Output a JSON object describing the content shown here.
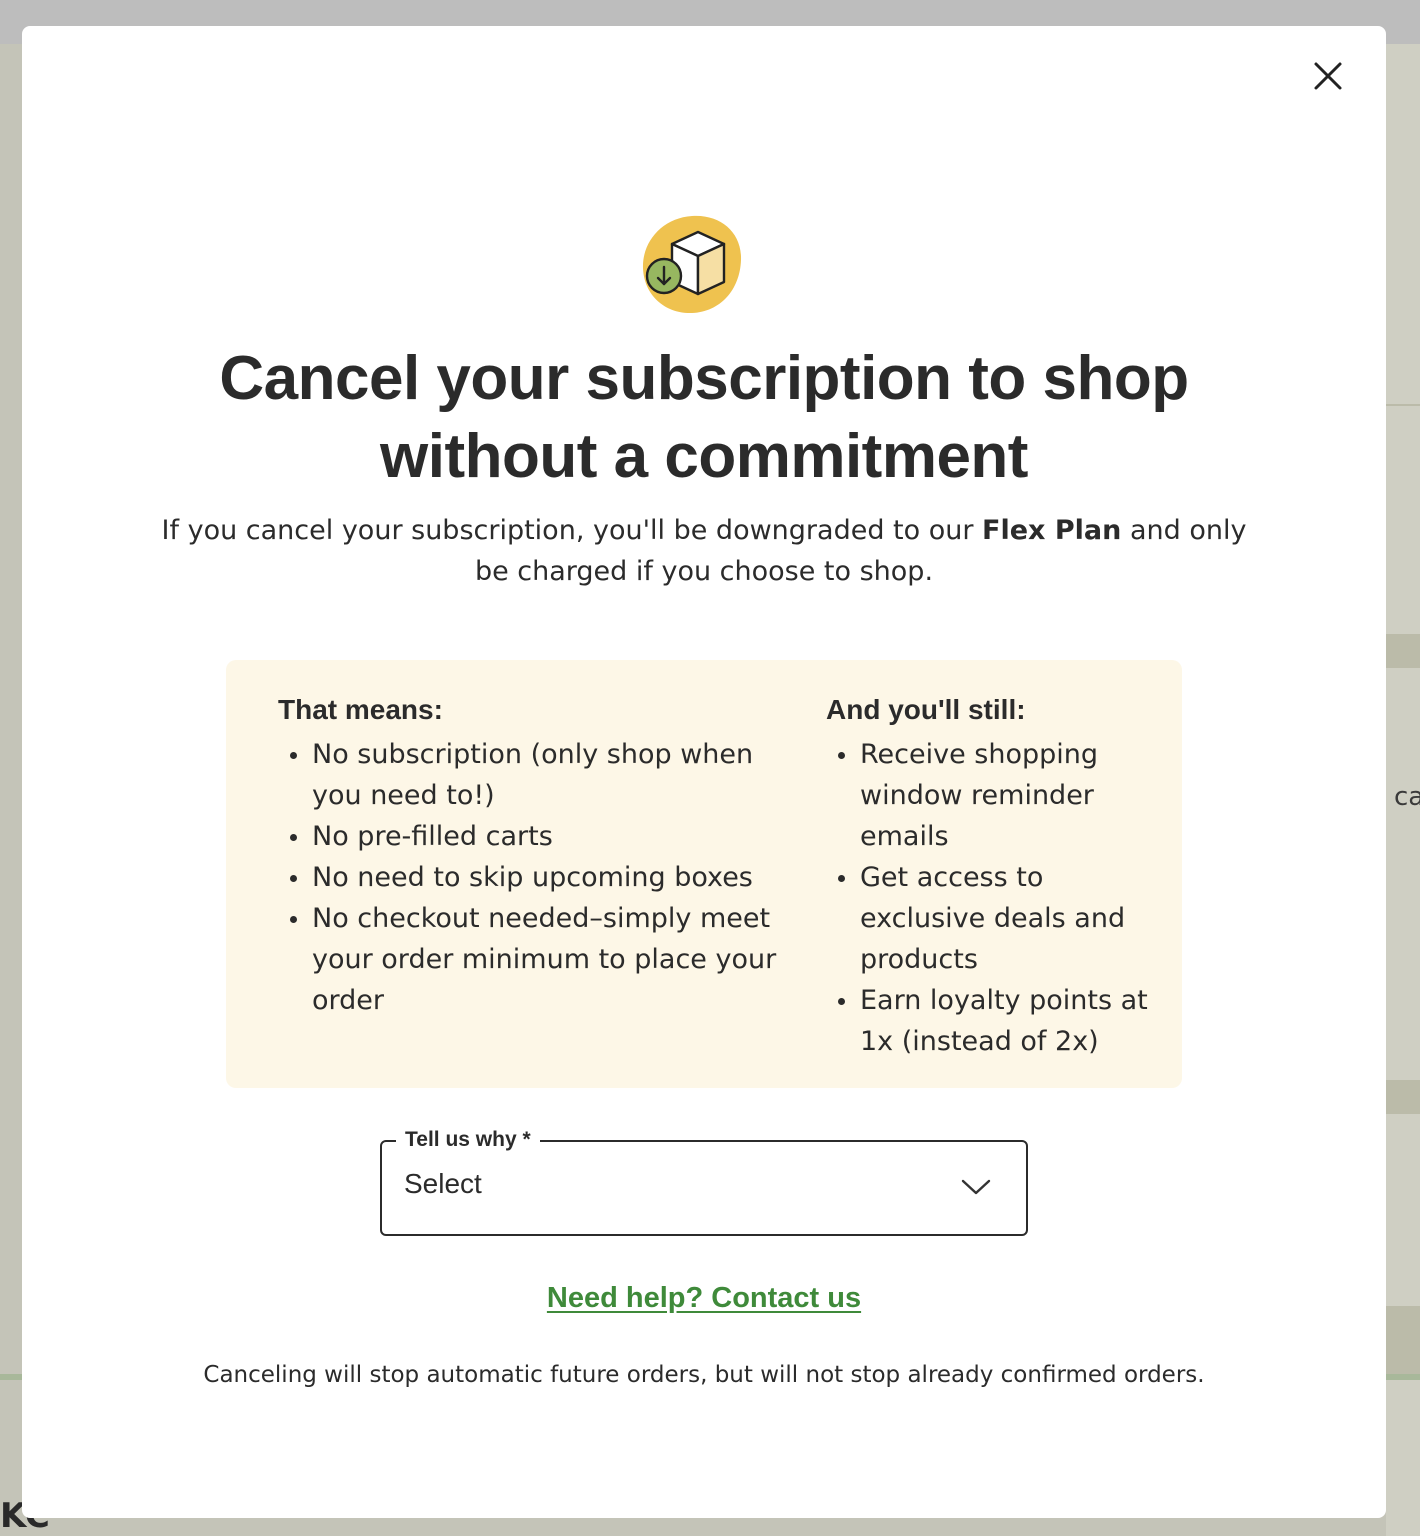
{
  "backdrop": {
    "partial_text": "ca",
    "logo_fragment": "KC"
  },
  "modal": {
    "close_label": "×",
    "icon": "box-download-icon",
    "title": "Cancel your subscription to shop without a commitment",
    "subtitle": {
      "before": "If you cancel your subscription, you'll be downgraded to our ",
      "bold": "Flex Plan",
      "after": " and only be charged if you choose to shop."
    },
    "info": {
      "left_heading": "That means:",
      "left_items": [
        "No subscription (only shop when you need to!)",
        "No pre-filled carts",
        "No need to skip upcoming boxes",
        "No checkout needed–simply meet your order minimum to place your order"
      ],
      "right_heading": "And you'll still:",
      "right_items": [
        "Receive shopping window reminder emails",
        "Get access to exclusive deals and products",
        "Earn loyalty points at 1x (instead of 2x)"
      ]
    },
    "reason_select": {
      "label": "Tell us why *",
      "value": "Select"
    },
    "help_link": "Need help? Contact us",
    "footnote": "Canceling will stop automatic future orders, but will not stop already confirmed orders."
  },
  "colors": {
    "accent_green": "#3f8a3a",
    "info_bg": "#fdf7e7",
    "icon_yellow": "#efc24f"
  }
}
